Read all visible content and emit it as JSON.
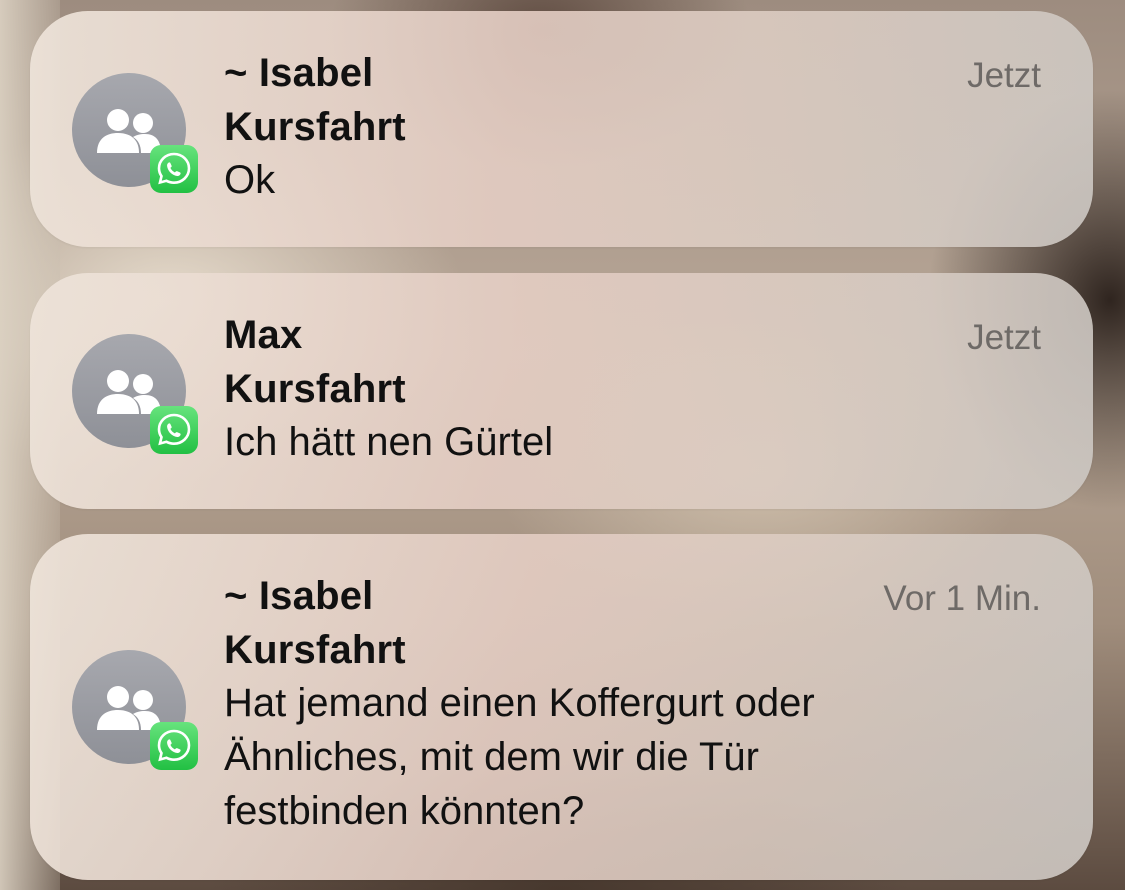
{
  "notifications": [
    {
      "sender": "~ Isabel",
      "group": "Kursfahrt",
      "message_lines": [
        "Ok"
      ],
      "time": "Jetzt",
      "avatar_icon": "group-avatar-icon",
      "app_icon": "whatsapp-icon"
    },
    {
      "sender": "Max",
      "group": "Kursfahrt",
      "message_lines": [
        "Ich hätt nen Gürtel"
      ],
      "time": "Jetzt",
      "avatar_icon": "group-avatar-icon",
      "app_icon": "whatsapp-icon"
    },
    {
      "sender": "~ Isabel",
      "group": "Kursfahrt",
      "message_lines": [
        "Hat jemand einen Koffergurt oder",
        "Ähnliches, mit dem wir die Tür",
        "festbinden könnten?"
      ],
      "time": "Vor 1 Min.",
      "avatar_icon": "group-avatar-icon",
      "app_icon": "whatsapp-icon"
    }
  ],
  "colors": {
    "avatar": "#9a9ba1",
    "whatsapp_green": "#2fc94e",
    "time_text": "#6e6a67"
  }
}
